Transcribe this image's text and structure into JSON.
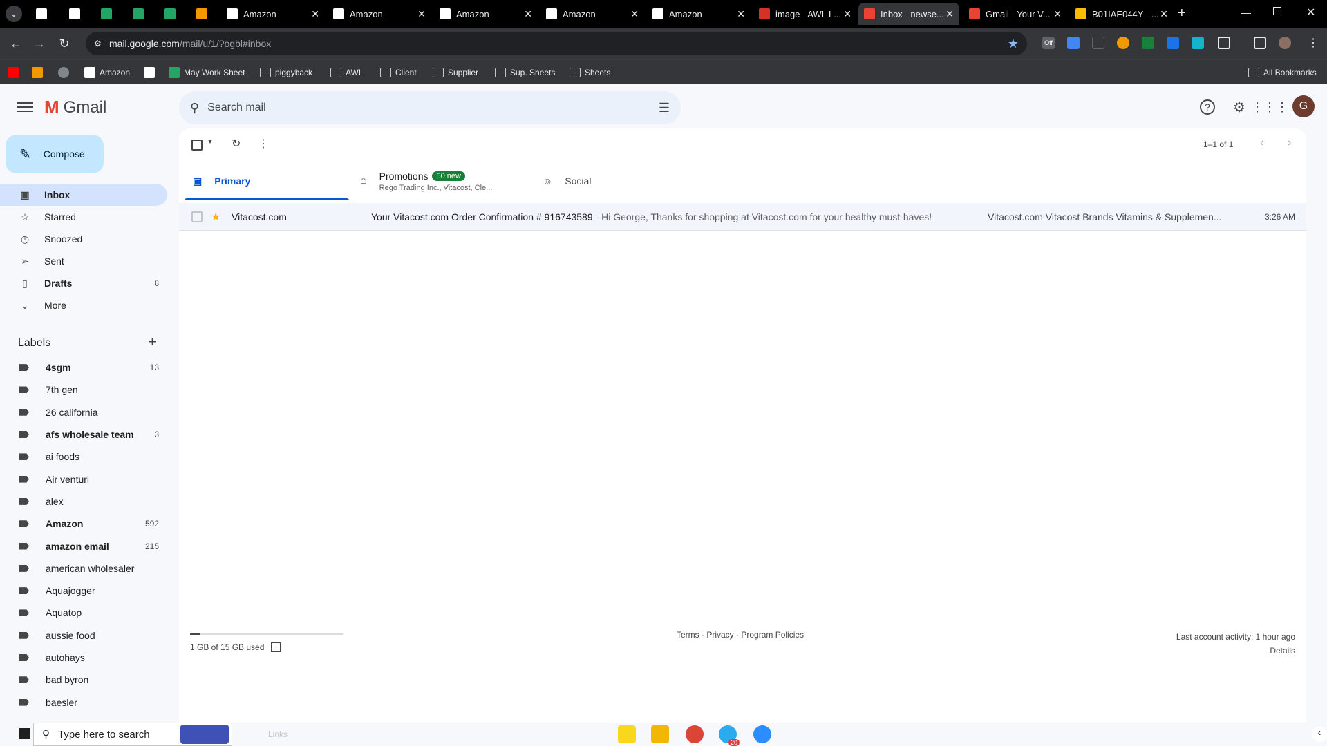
{
  "browser": {
    "tabs": [
      {
        "title": "Amazon"
      },
      {
        "title": "Amazon"
      },
      {
        "title": "Amazon"
      },
      {
        "title": "Amazon"
      },
      {
        "title": "Amazon"
      },
      {
        "title": "image - AWL L..."
      },
      {
        "title": "Inbox - newse..."
      },
      {
        "title": "Gmail - Your V..."
      },
      {
        "title": "B01IAE044Y - ..."
      }
    ],
    "url_main": "mail.google.com",
    "url_rest": "/mail/u/1/?ogbl#inbox",
    "bookmarks": [
      "Amazon",
      "May Work Sheet",
      "piggyback",
      "AWL",
      "Client",
      "Supplier",
      "Sup. Sheets",
      "Sheets"
    ],
    "all_bookmarks": "All Bookmarks",
    "ext_badge": "Off"
  },
  "gmail": {
    "brand": "Gmail",
    "search_placeholder": "Search mail",
    "avatar_letter": "G",
    "compose": "Compose",
    "nav": [
      {
        "label": "Inbox",
        "icon": "inbox-icon",
        "count": ""
      },
      {
        "label": "Starred",
        "icon": "star-icon",
        "count": ""
      },
      {
        "label": "Snoozed",
        "icon": "clock-icon",
        "count": ""
      },
      {
        "label": "Sent",
        "icon": "send-icon",
        "count": ""
      },
      {
        "label": "Drafts",
        "icon": "file-icon",
        "count": "8"
      },
      {
        "label": "More",
        "icon": "chevron-down-icon",
        "count": ""
      }
    ],
    "labels_heading": "Labels",
    "labels": [
      {
        "name": "4sgm",
        "count": "13"
      },
      {
        "name": "7th gen",
        "count": ""
      },
      {
        "name": "26 california",
        "count": ""
      },
      {
        "name": "afs wholesale team",
        "count": "3"
      },
      {
        "name": "ai foods",
        "count": ""
      },
      {
        "name": "Air venturi",
        "count": ""
      },
      {
        "name": "alex",
        "count": ""
      },
      {
        "name": "Amazon",
        "count": "592"
      },
      {
        "name": "amazon email",
        "count": "215"
      },
      {
        "name": "american wholesaler",
        "count": ""
      },
      {
        "name": "Aquajogger",
        "count": ""
      },
      {
        "name": "Aquatop",
        "count": ""
      },
      {
        "name": "aussie food",
        "count": ""
      },
      {
        "name": "autohays",
        "count": ""
      },
      {
        "name": "bad byron",
        "count": ""
      },
      {
        "name": "baesler",
        "count": ""
      }
    ],
    "pagination": "1–1 of 1",
    "tabs": {
      "primary": "Primary",
      "promotions": "Promotions",
      "promotions_badge": "50 new",
      "promotions_sub": "Rego Trading Inc., Vitacost, Cle...",
      "social": "Social"
    },
    "email": {
      "sender": "Vitacost.com",
      "subject": "Your Vitacost.com Order Confirmation # 916743589",
      "snippet": " - Hi George, Thanks for shopping at Vitacost.com for your healthy must-haves!",
      "labels": "Vitacost.com Vitacost Brands Vitamins & Supplemen...",
      "time": "3:26 AM"
    },
    "footer": {
      "storage": "1 GB of 15 GB used",
      "storage_fraction": 0.067,
      "terms": "Terms",
      "privacy": "Privacy",
      "policies": "Program Policies",
      "activity": "Last account activity: 1 hour ago",
      "details": "Details"
    }
  },
  "taskbar": {
    "search_placeholder": "Type here to search",
    "links": "Links",
    "badge": "20"
  }
}
